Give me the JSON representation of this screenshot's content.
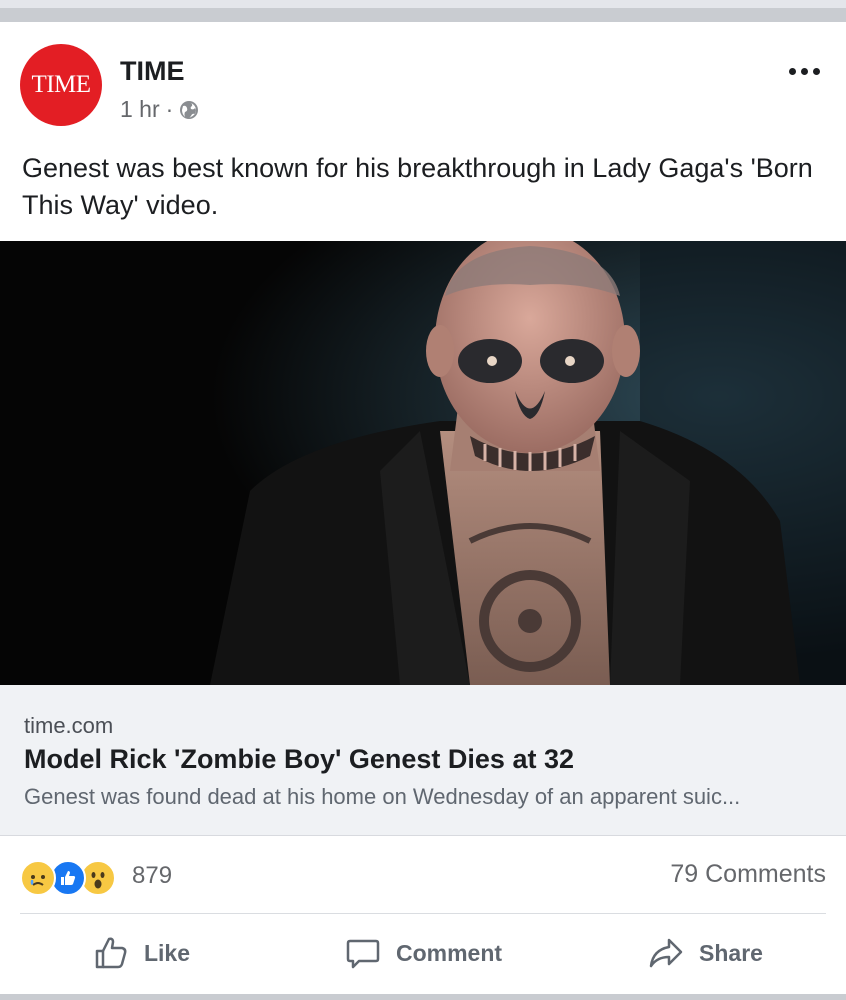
{
  "post": {
    "page_name": "TIME",
    "avatar_text": "TIME",
    "time": "1 hr",
    "separator": "·",
    "privacy_icon": "globe-icon",
    "caption": "Genest was best known for his breakthrough in Lady Gaga's 'Born This Way' video."
  },
  "link_preview": {
    "domain": "time.com",
    "headline": "Model Rick 'Zombie Boy' Genest Dies at 32",
    "description": "Genest was found dead at his home on Wednesday of an apparent suic..."
  },
  "engagement": {
    "reaction_icons": [
      "sad-reaction-icon",
      "like-reaction-icon",
      "wow-reaction-icon"
    ],
    "reaction_count": "879",
    "comments_count": "79 Comments"
  },
  "actions": {
    "like": "Like",
    "comment": "Comment",
    "share": "Share"
  },
  "colors": {
    "brand_red": "#e31e24",
    "like_blue": "#1877f2",
    "reaction_yellow": "#f7c843",
    "text_secondary": "#65676b"
  }
}
